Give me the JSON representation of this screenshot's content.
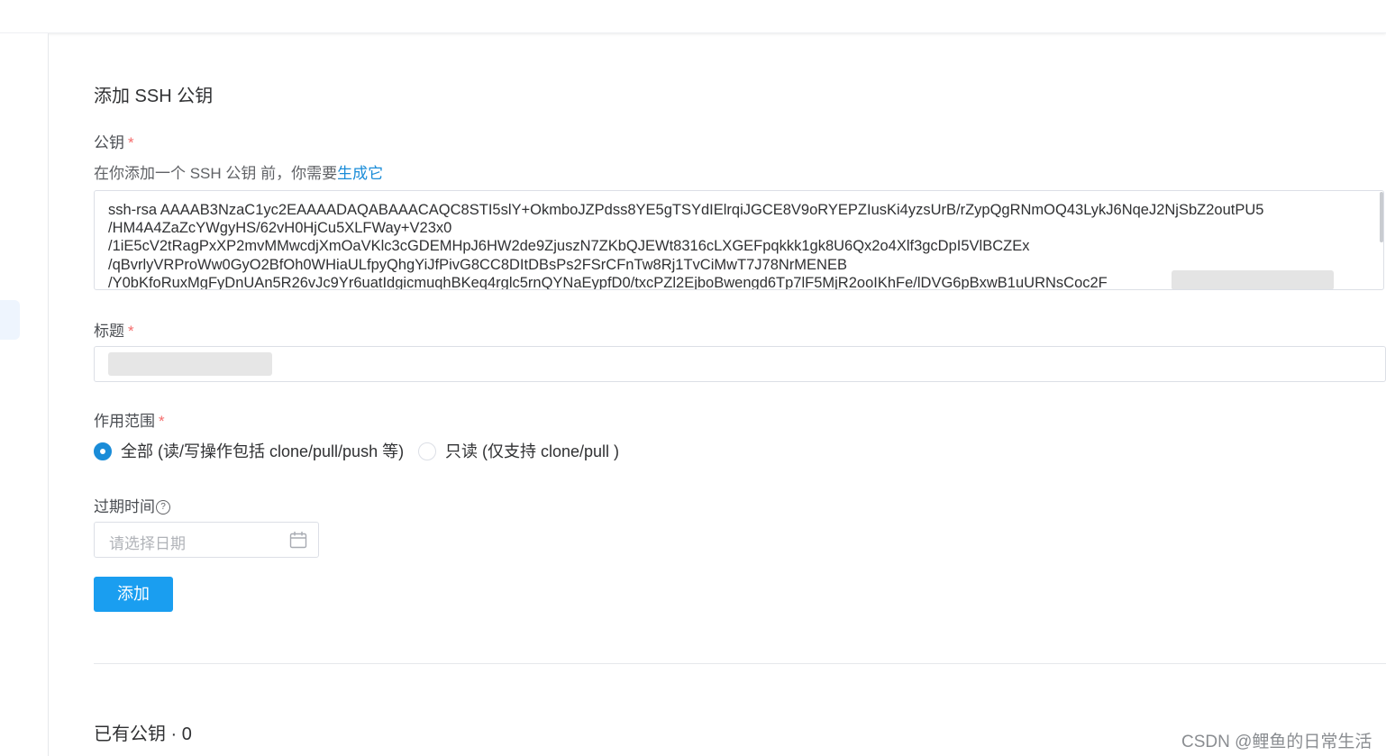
{
  "form": {
    "title": "添加 SSH 公钥",
    "public_key_label": "公钥",
    "required_mark": "*",
    "hint_text": "在你添加一个 SSH 公钥 前，你需要",
    "hint_link": "生成它",
    "public_key_lines": [
      "ssh-rsa AAAAB3NzaC1yc2EAAAADAQABAAACAQC8STI5slY+OkmboJZPdss8YE5gTSYdIElrqiJGCE8V9oRYEPZIusKi4yzsUrB/rZypQgRNmOQ43LykJ6NqeJ2NjSbZ2outPU5",
      "/HM4A4ZaZcYWgyHS/62vH0HjCu5XLFWay+V23x0",
      "/1iE5cV2tRagPxXP2mvMMwcdjXmOaVKlc3cGDEMHpJ6HW2de9ZjuszN7ZKbQJEWt8316cLXGEFpqkkk1gk8U6Qx2o4Xlf3gcDpI5VlBCZEx",
      "/qBvrlyVRProWw0GyO2BfOh0WHiaULfpyQhgYiJfPivG8CC8DItDBsPs2FSrCFnTw8Rj1TvCiMwT7J78NrMENEB",
      "/Y0bKfoRuxMgFyDnUAn5R26vJc9Yr6uatIdgicmuqhBKeq4rglc5rnQYNaEypfD0/txcPZl2EjboBwengd6Tp7lF5MjR2ooIKhFe/lDVG6pBxwB1uURNsCoc2F"
    ],
    "title_label": "标题",
    "scope_label": "作用范围",
    "scope_options": [
      {
        "label": "全部 (读/写操作包括 clone/pull/push 等)",
        "checked": true
      },
      {
        "label": "只读 (仅支持 clone/pull )",
        "checked": false
      }
    ],
    "expiry_label": "过期时间",
    "help_glyph": "?",
    "date_placeholder": "请选择日期",
    "submit_label": "添加"
  },
  "existing_keys": {
    "heading": "已有公钥 · 0"
  },
  "watermark": "CSDN @鲤鱼的日常生活",
  "colors": {
    "accent": "#1a9ef0",
    "link": "#1a8cd8",
    "required": "#f56c6c"
  }
}
